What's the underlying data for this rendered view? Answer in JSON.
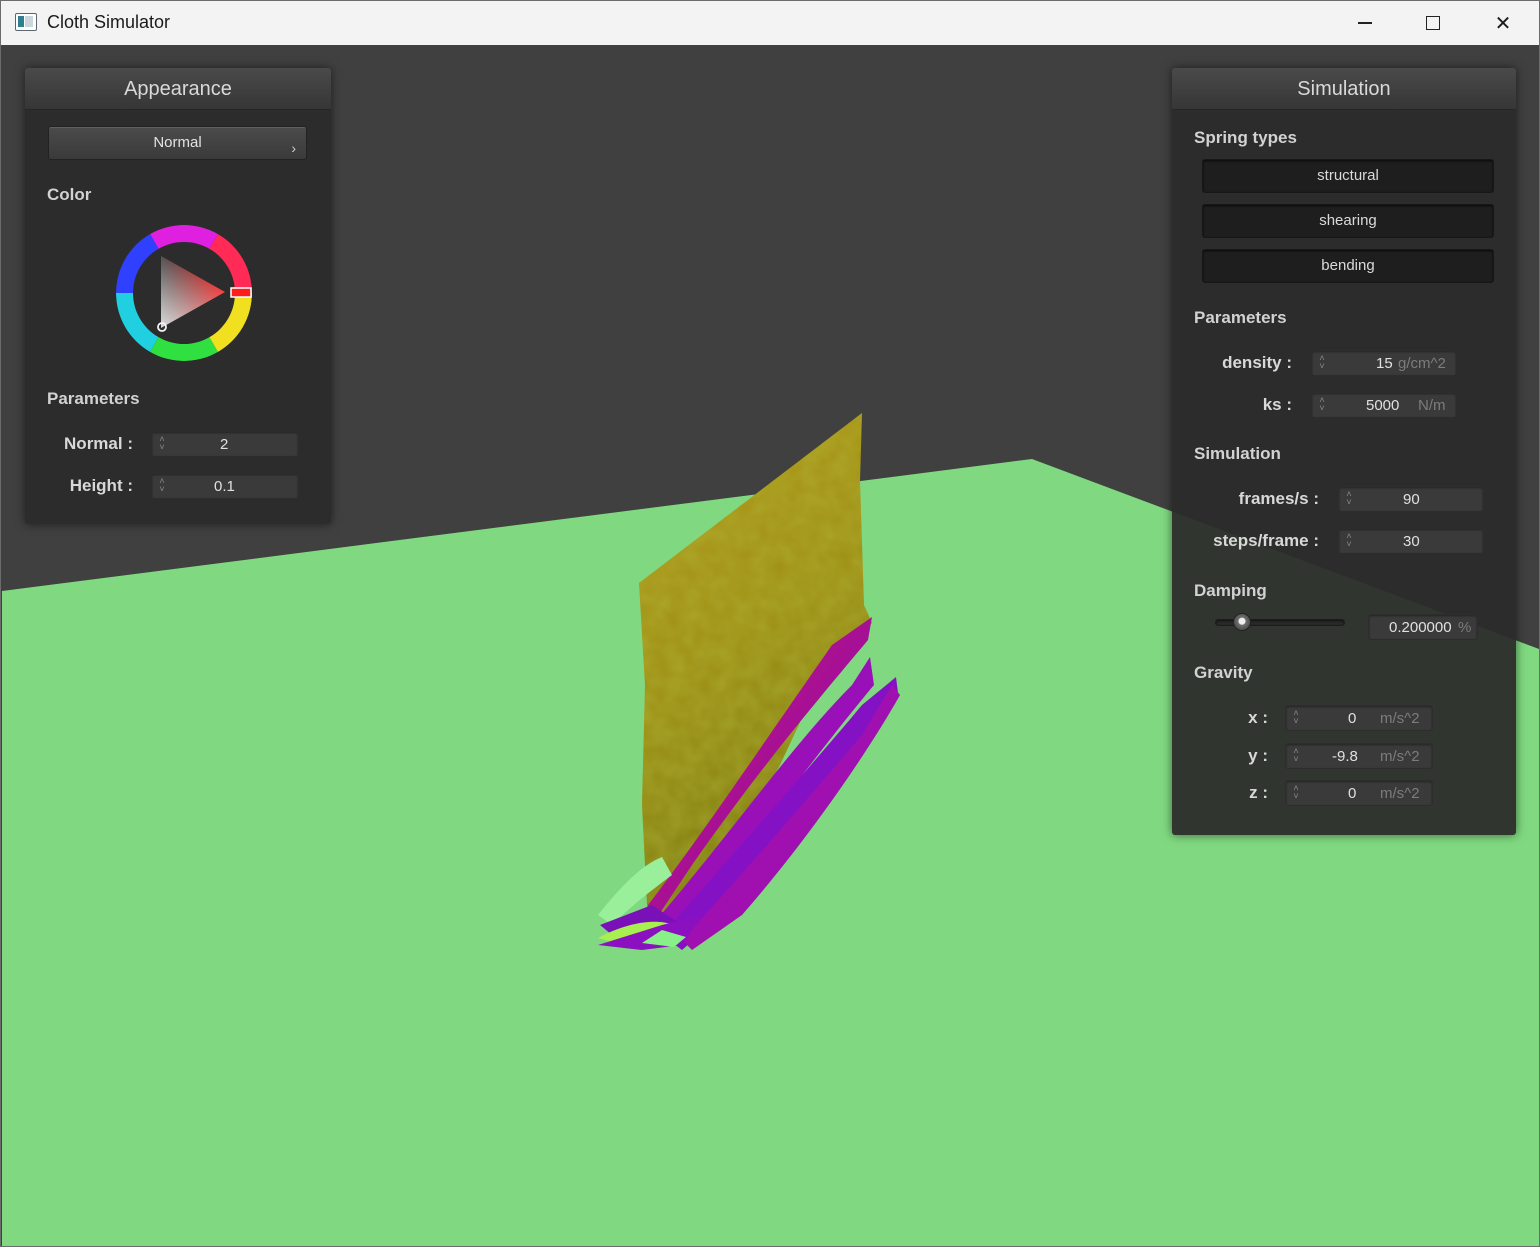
{
  "window": {
    "title": "Cloth Simulator"
  },
  "appearance": {
    "title": "Appearance",
    "shader": "Normal",
    "color_label": "Color",
    "color_value": "#e02020",
    "params_label": "Parameters",
    "normal_label": "Normal :",
    "normal_value": "2",
    "height_label": "Height :",
    "height_value": "0.1"
  },
  "simulation": {
    "title": "Simulation",
    "spring_types_label": "Spring types",
    "springs": [
      "structural",
      "shearing",
      "bending"
    ],
    "params_label": "Parameters",
    "density_label": "density :",
    "density_value": "15",
    "density_unit": "g/cm^2",
    "ks_label": "ks :",
    "ks_value": "5000",
    "ks_unit": "N/m",
    "sim_label": "Simulation",
    "fps_label": "frames/s :",
    "fps_value": "90",
    "steps_label": "steps/frame :",
    "steps_value": "30",
    "damping_label": "Damping",
    "damping_value": "0.200000",
    "damping_unit": "%",
    "damping_fraction": 0.2,
    "gravity_label": "Gravity",
    "gx_label": "x :",
    "gx_value": "0",
    "gy_label": "y :",
    "gy_value": "-9.8",
    "gz_label": "z :",
    "gz_value": "0",
    "g_unit": "m/s^2"
  },
  "colors": {
    "ground": "#80d980",
    "background": "#404040",
    "cloth_top": "#b8a019",
    "cloth_fold": "#8a10b0"
  }
}
